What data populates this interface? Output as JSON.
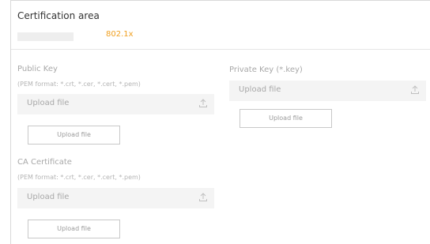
{
  "section": {
    "title": "Certification area",
    "active_tab": "802.1x"
  },
  "public_key": {
    "label": "Public Key",
    "hint": "(PEM format: *.crt, *.cer, *.cert, *.pem)",
    "placeholder": "Upload file",
    "button": "Upload file"
  },
  "private_key": {
    "label": "Private Key (*.key)",
    "placeholder": "Upload file",
    "button": "Upload file"
  },
  "ca_certificate": {
    "label": "CA Certificate",
    "hint": "(PEM format: *.crt, *.cer, *.cert, *.pem)",
    "placeholder": "Upload file",
    "button": "Upload file"
  },
  "icons": {
    "upload": "upload-icon"
  },
  "colors": {
    "accent": "#f0a020",
    "input_bg": "#f4f4f4",
    "muted_text": "#a8a8a8"
  }
}
